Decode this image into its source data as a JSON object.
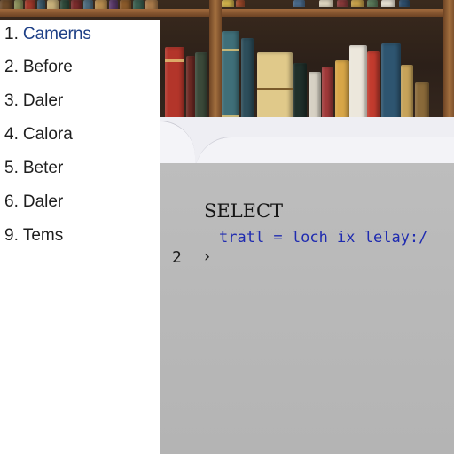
{
  "list": {
    "items": [
      {
        "number": "1.",
        "label": "Camerns"
      },
      {
        "number": "2.",
        "label": "Before"
      },
      {
        "number": "3.",
        "label": "Daler"
      },
      {
        "number": "4.",
        "label": "Calora"
      },
      {
        "number": "5.",
        "label": "Beter"
      },
      {
        "number": "6.",
        "label": "Daler"
      },
      {
        "number": "9.",
        "label": "Tems"
      }
    ],
    "active_index": 0
  },
  "editor": {
    "keyword": "SELECT",
    "code_line": "tratl = loch ix lelay:/",
    "line_number": "2",
    "prompt_symbol": "›"
  },
  "colors": {
    "active_item": "#1d3f86",
    "code_text": "#1f2bb0",
    "editor_bg": "#b9b9b9"
  }
}
